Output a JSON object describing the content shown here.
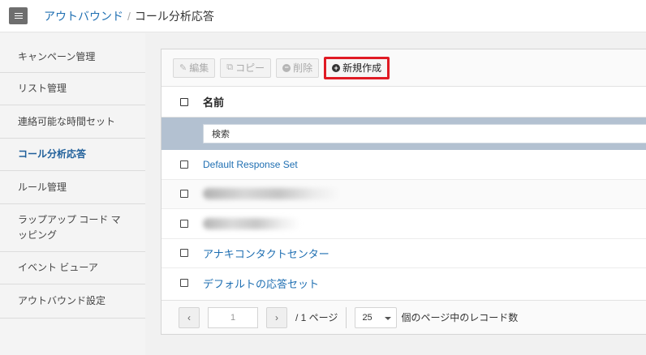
{
  "header": {
    "breadcrumb_root": "アウトバウンド",
    "breadcrumb_separator": "/",
    "breadcrumb_current": "コール分析応答"
  },
  "sidebar": {
    "items": [
      {
        "label": "キャンペーン管理"
      },
      {
        "label": "リスト管理"
      },
      {
        "label": "連絡可能な時間セット"
      },
      {
        "label": "コール分析応答",
        "active": true
      },
      {
        "label": "ルール管理"
      },
      {
        "label": "ラップアップ コード マッピング"
      },
      {
        "label": "イベント ビューア"
      },
      {
        "label": "アウトバウンド設定"
      }
    ]
  },
  "toolbar": {
    "edit_label": "編集",
    "copy_label": "コピー",
    "delete_label": "削除",
    "create_label": "新規作成"
  },
  "table": {
    "header_name": "名前",
    "search_value": "検索",
    "rows": [
      {
        "name": "Default Response Set"
      },
      {
        "name": ""
      },
      {
        "name": ""
      },
      {
        "name": "アナキコンタクトセンター"
      },
      {
        "name": "デフォルトの応答セット"
      }
    ]
  },
  "pager": {
    "prev_symbol": "‹",
    "next_symbol": "›",
    "current_page": "1",
    "total_text": "/ 1 ページ",
    "page_size": "25",
    "page_size_label": "個のページ中のレコード数"
  },
  "colors": {
    "accent": "#1f6fb2",
    "highlight_border": "#e01b24",
    "search_band": "#b3c1d1"
  }
}
